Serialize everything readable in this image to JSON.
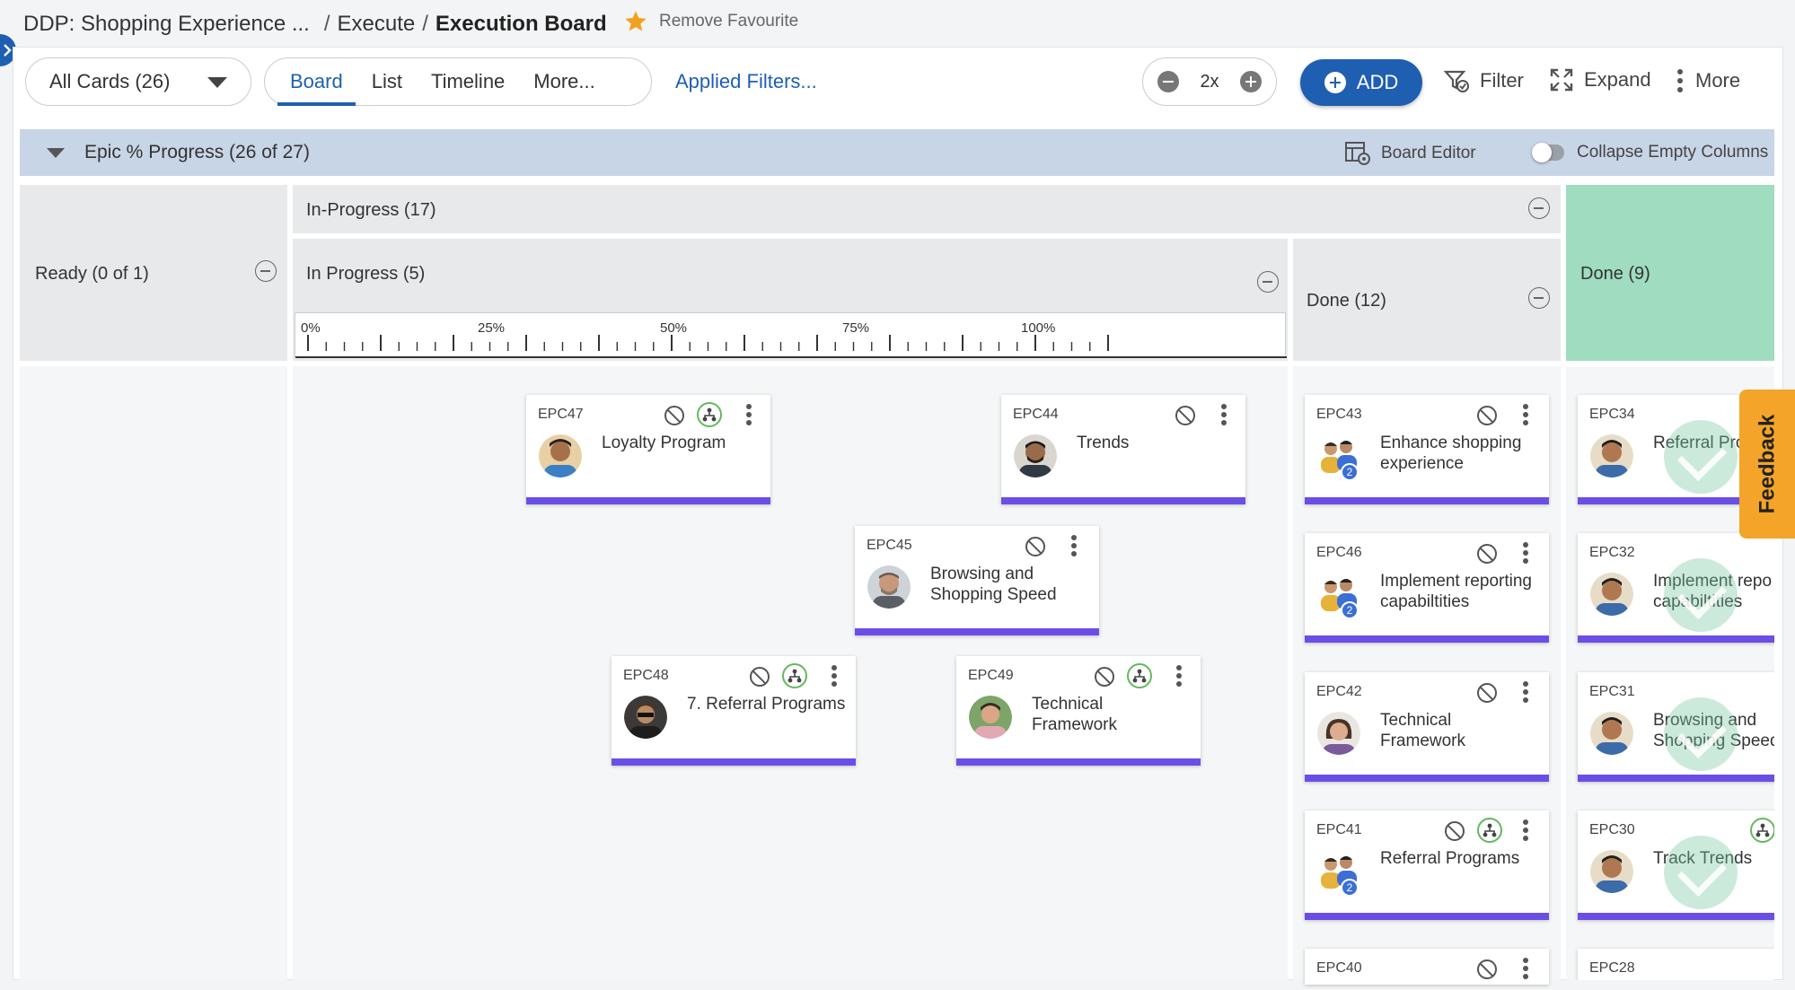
{
  "breadcrumb": {
    "project": "DDP: Shopping Experience ...",
    "sep": "/",
    "section": "Execute",
    "current": "Execution Board"
  },
  "favourite": {
    "label": "Remove Favourite",
    "icon": "star-icon",
    "color": "#f2a11f"
  },
  "toolbar": {
    "all_cards": "All Cards (26)",
    "views": [
      "Board",
      "List",
      "Timeline",
      "More..."
    ],
    "active_view": "Board",
    "applied_filters": "Applied Filters...",
    "zoom": "2x",
    "add": "ADD",
    "filter": "Filter",
    "expand": "Expand",
    "more": "More"
  },
  "epic_bar": {
    "title": "Epic % Progress (26 of 27)",
    "board_editor": "Board Editor",
    "collapse_empty": "Collapse Empty Columns",
    "collapse_enabled": false
  },
  "columns": {
    "ready": "Ready (0 of 1)",
    "in_progress_group": "In-Progress (17)",
    "in_progress": "In Progress (5)",
    "done_group_col": "Done (12)",
    "done": "Done (9)"
  },
  "scale_labels": [
    "0%",
    "25%",
    "50%",
    "75%",
    "100%"
  ],
  "colors": {
    "accent": "#1f5fb2",
    "card_bar": "#6b4ee6",
    "done_header": "#9fdcc0",
    "feedback": "#f4a428",
    "dependency": "#63b95d"
  },
  "cards": {
    "epc47": {
      "id": "EPC47",
      "title": "Loyalty Program"
    },
    "epc44": {
      "id": "EPC44",
      "title": "Trends"
    },
    "epc45": {
      "id": "EPC45",
      "title": "Browsing and Shopping Speed"
    },
    "epc48": {
      "id": "EPC48",
      "title": "7. Referral Programs"
    },
    "epc49": {
      "id": "EPC49",
      "title": "Technical Framework"
    },
    "epc43": {
      "id": "EPC43",
      "title": "Enhance shopping experience",
      "badge": "2"
    },
    "epc46": {
      "id": "EPC46",
      "title": "Implement reporting capabiltities",
      "badge": "2"
    },
    "epc42": {
      "id": "EPC42",
      "title": "Technical Framework"
    },
    "epc41": {
      "id": "EPC41",
      "title": "Referral Programs",
      "badge": "2"
    },
    "epc40": {
      "id": "EPC40"
    },
    "epc34": {
      "id": "EPC34",
      "title": "Referral Pro"
    },
    "epc32": {
      "id": "EPC32",
      "title": "Implement repo capabiltities"
    },
    "epc31": {
      "id": "EPC31",
      "title": "Browsing and Shopping Speed"
    },
    "epc30": {
      "id": "EPC30",
      "title": "Track Trends"
    },
    "epc28": {
      "id": "EPC28"
    }
  },
  "feedback": "Feedback"
}
